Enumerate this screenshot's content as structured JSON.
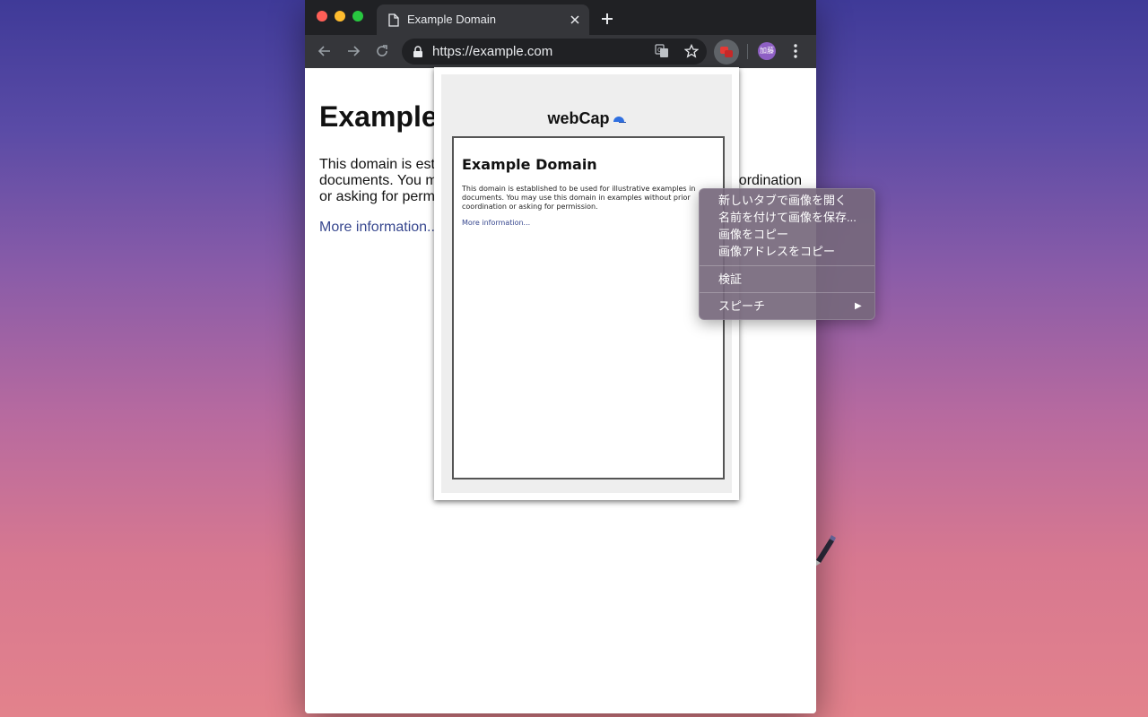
{
  "browser": {
    "tab_title": "Example Domain",
    "url": "https://example.com",
    "profile_avatar": "加藤",
    "icons": [
      "document-icon",
      "close-icon",
      "plus-icon",
      "back-arrow-icon",
      "forward-arrow-icon",
      "reload-icon",
      "lock-icon",
      "translate-icon",
      "star-icon",
      "webcap-extension-icon",
      "more-vert-icon"
    ]
  },
  "page": {
    "heading": "Example Domain",
    "paragraph": "This domain is established to be used for illustrative examples in documents. You may use this domain in examples without prior coordination or asking for permission.",
    "link": "More information..."
  },
  "popup": {
    "brand": "webCap",
    "brand_icon": "cap-icon",
    "preview": {
      "heading": "Example Domain",
      "paragraph": "This domain is established to be used for illustrative examples in documents. You may use this domain in examples without prior coordination or asking for permission.",
      "link": "More information..."
    }
  },
  "context_menu": {
    "items": [
      "新しいタブで画像を開く",
      "名前を付けて画像を保存...",
      "画像をコピー",
      "画像アドレスをコピー"
    ],
    "inspect": "検証",
    "speech": "スピーチ",
    "submenu_arrow": "▶"
  },
  "colors": {
    "tab_bar": "#202124",
    "toolbar": "#35363a",
    "link": "#38488f",
    "menu_bg": "#76687c"
  }
}
